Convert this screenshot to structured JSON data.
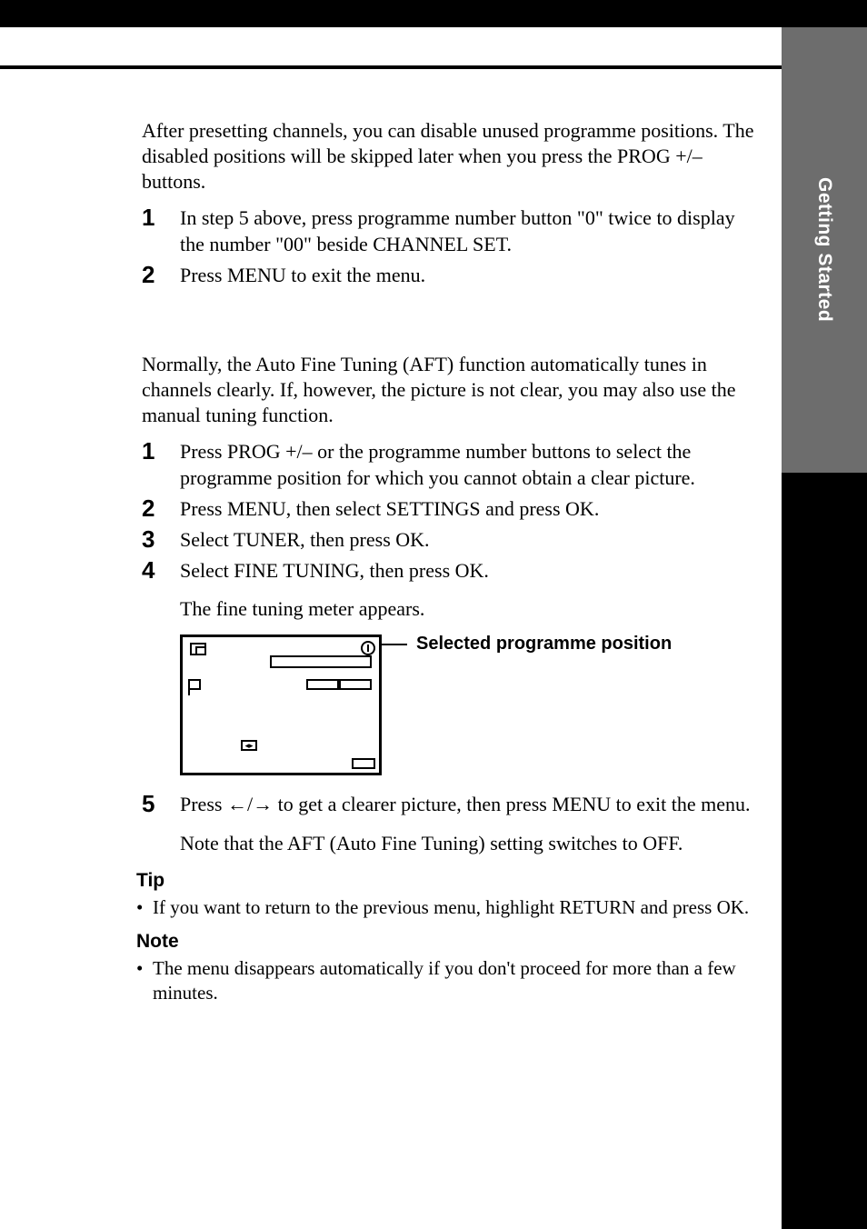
{
  "sidebar": {
    "label": "Getting Started"
  },
  "section1": {
    "intro": "After presetting channels, you can disable unused programme positions. The disabled positions will be skipped later when you press the PROG +/– buttons.",
    "steps": [
      {
        "n": "1",
        "t": "In step 5 above, press programme number button \"0\" twice to display the number \"00\" beside CHANNEL SET."
      },
      {
        "n": "2",
        "t": "Press MENU to exit the menu."
      }
    ]
  },
  "section2": {
    "intro": "Normally, the Auto Fine Tuning (AFT) function automatically tunes in channels clearly.  If, however, the picture is not clear, you may also use the manual tuning function.",
    "steps_a": [
      {
        "n": "1",
        "t": "Press PROG +/– or the programme number buttons to select the programme position for which you cannot obtain a clear picture."
      },
      {
        "n": "2",
        "t": "Press MENU, then select SETTINGS and press OK."
      },
      {
        "n": "3",
        "t": "Select TUNER, then press OK."
      },
      {
        "n": "4",
        "t": "Select FINE TUNING, then press OK."
      }
    ],
    "sub_after4": "The fine tuning meter appears.",
    "diagram_callout": "Selected programme position",
    "step5": {
      "n": "5",
      "t_pre": "Press ",
      "t_post": " to get a clearer picture, then press MENU to exit the menu."
    },
    "sub_after5": "Note that the AFT (Auto Fine Tuning) setting switches to OFF."
  },
  "tip": {
    "head": "Tip",
    "item": "If you want to return to the previous menu, highlight RETURN and press OK."
  },
  "note": {
    "head": "Note",
    "item": "The menu disappears automatically if you don't proceed for more than a few minutes."
  }
}
